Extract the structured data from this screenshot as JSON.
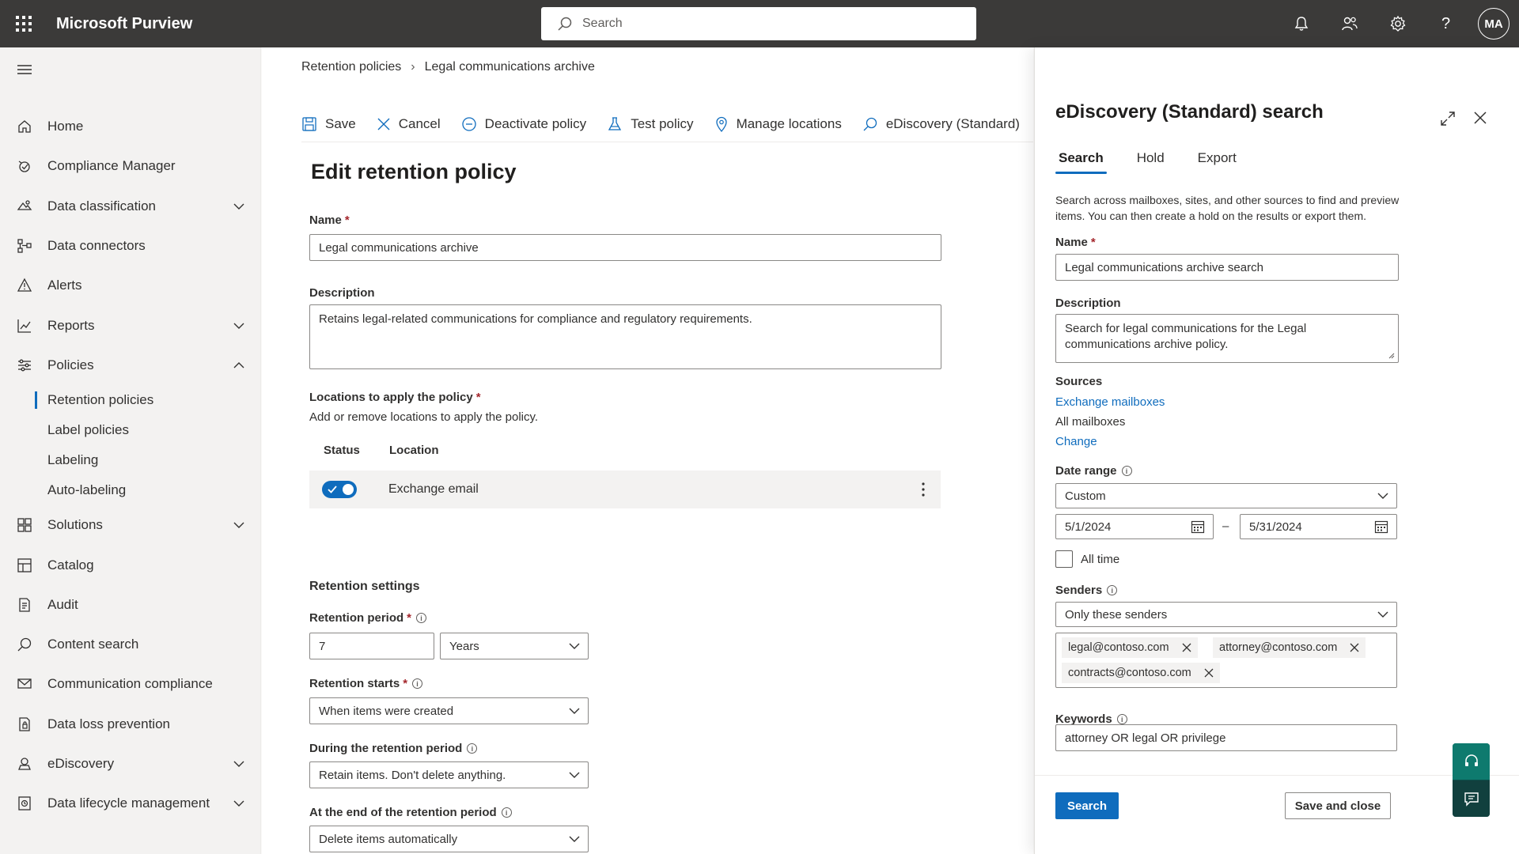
{
  "app": {
    "title": "Microsoft Purview",
    "search_placeholder": "Search",
    "avatar_initials": "MA"
  },
  "sidebar": {
    "items": [
      {
        "label": "Home",
        "icon": "home-icon"
      },
      {
        "label": "Compliance Manager",
        "icon": "compliance-manager-icon"
      },
      {
        "label": "Data classification",
        "icon": "data-classification-icon",
        "expandable": true
      },
      {
        "label": "Data connectors",
        "icon": "data-connectors-icon"
      },
      {
        "label": "Alerts",
        "icon": "alert-icon"
      },
      {
        "label": "Reports",
        "icon": "reports-icon",
        "expandable": true
      },
      {
        "label": "Policies",
        "icon": "policies-icon",
        "expanded": true
      }
    ],
    "policies_subitems": [
      {
        "label": "Retention policies",
        "active": true
      },
      {
        "label": "Label policies"
      },
      {
        "label": "Labeling"
      },
      {
        "label": "Auto-labeling"
      }
    ],
    "items_after": [
      {
        "label": "Solutions",
        "icon": "solutions-icon",
        "expandable": true
      },
      {
        "label": "Catalog",
        "icon": "catalog-icon"
      },
      {
        "label": "Audit",
        "icon": "audit-icon"
      },
      {
        "label": "Content search",
        "icon": "search-icon"
      },
      {
        "label": "Communication compliance",
        "icon": "communication-icon"
      },
      {
        "label": "Data loss prevention",
        "icon": "dlp-icon"
      },
      {
        "label": "eDiscovery",
        "icon": "ediscovery-icon",
        "expandable": true
      },
      {
        "label": "Data lifecycle management",
        "icon": "lifecycle-icon",
        "expandable": true
      }
    ]
  },
  "breadcrumb": {
    "parent": "Retention policies",
    "current": "Legal communications archive"
  },
  "commands": {
    "save": "Save",
    "cancel": "Cancel",
    "deactivate": "Deactivate policy",
    "test": "Test policy",
    "manage_locations": "Manage locations",
    "ediscovery": "eDiscovery (Standard)"
  },
  "form": {
    "title": "Edit retention policy",
    "name_label": "Name",
    "name_value": "Legal communications archive",
    "description_label": "Description",
    "description_value": "Retains legal-related communications for compliance and regulatory requirements.",
    "locations_label": "Locations to apply the policy",
    "locations_helper": "Add or remove locations to apply the policy.",
    "col_status": "Status",
    "col_location": "Location",
    "location_row": "Exchange email",
    "retention_settings": "Retention settings",
    "retention_period_label": "Retention period",
    "retention_period_value": "7",
    "retention_period_unit": "Years",
    "retention_starts_label": "Retention starts",
    "retention_starts_value": "When items were created",
    "during_label": "During the retention period",
    "during_value": "Retain items. Don't delete anything.",
    "end_label": "At the end of the retention period",
    "end_value": "Delete items automatically"
  },
  "panel": {
    "title": "eDiscovery (Standard) search",
    "tabs": [
      "Search",
      "Hold",
      "Export"
    ],
    "description": "Search across mailboxes, sites, and other sources to find and preview items. You can then create a hold on the results or export them.",
    "name_label": "Name",
    "name_value": "Legal communications archive search",
    "description_label": "Description",
    "description_value": "Search for legal communications for the Legal communications archive policy.",
    "sources_label": "Sources",
    "sources_link": "Exchange mailboxes",
    "sources_value": "All mailboxes",
    "change_link": "Change",
    "date_range_label": "Date range",
    "date_range_value": "Custom",
    "date_from": "5/1/2024",
    "date_sep": "–",
    "date_to": "5/31/2024",
    "all_time_label": "All time",
    "senders_label": "Senders",
    "senders_value": "Only these senders",
    "sender_tags": [
      "legal@contoso.com",
      "attorney@contoso.com",
      "contracts@contoso.com"
    ],
    "keywords_label": "Keywords",
    "keywords_value": "attorney OR legal OR privilege",
    "search_button": "Search",
    "save_close_button": "Save and close"
  },
  "colors": {
    "accent": "#0f6cbd",
    "topbar": "#3b3a39",
    "required": "#a4262c"
  }
}
